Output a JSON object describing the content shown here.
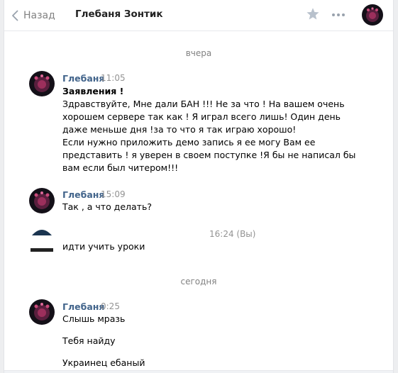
{
  "header": {
    "back_label": "Назад",
    "title": "Глебаня Зонтик"
  },
  "dates": {
    "yesterday": "вчера",
    "today": "сегодня"
  },
  "messages": [
    {
      "sender": "Глебаня",
      "time": "11:05",
      "lines": [
        "Заявления !",
        "Здравствуйте, Мне дали БАН !!! Не за что ! На вашем очень",
        "хорошем сервере так как ! Я играл всего лишь! Один день",
        "даже меньше дня !за то что я так играю хорошо!",
        "Если нужно приложить демо запись я ее могу Вам ее",
        "представить ! я уверен в своем поступке !Я бы не написал бы",
        "вам если был читером!!!"
      ]
    },
    {
      "sender": "Глебаня",
      "time": "15:09",
      "lines": [
        "Так , а что делать?"
      ]
    },
    {
      "sender": "",
      "time": "16:24 (Вы)",
      "lines": [
        "идти учить уроки"
      ]
    },
    {
      "sender": "Глебаня",
      "time": "0:25",
      "lines": [
        "Слышь мразь",
        "Тебя найду",
        "Украинец ебаный"
      ]
    }
  ],
  "icons": {
    "back": "chevron-left-icon",
    "favorite": "star-icon",
    "more": "more-dots-icon"
  },
  "colors": {
    "sender": "#42648b",
    "muted": "#828282",
    "background": "#edeef0"
  }
}
